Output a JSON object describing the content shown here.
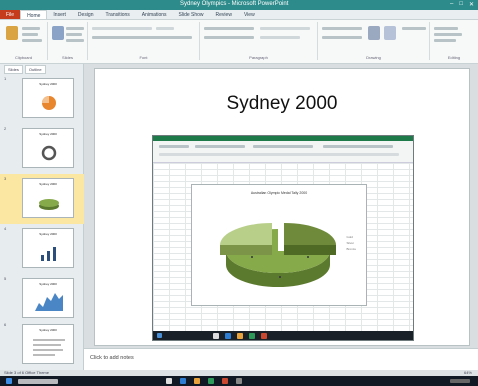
{
  "window": {
    "title": "Sydney Olympics - Microsoft PowerPoint",
    "controls": [
      "–",
      "□",
      "✕"
    ]
  },
  "tabs": [
    {
      "label": "File",
      "kind": "file"
    },
    {
      "label": "Home",
      "kind": "active"
    },
    {
      "label": "Insert",
      "kind": ""
    },
    {
      "label": "Design",
      "kind": ""
    },
    {
      "label": "Transitions",
      "kind": ""
    },
    {
      "label": "Animations",
      "kind": ""
    },
    {
      "label": "Slide Show",
      "kind": ""
    },
    {
      "label": "Review",
      "kind": ""
    },
    {
      "label": "View",
      "kind": ""
    }
  ],
  "ribbon": {
    "groups": [
      "Clipboard",
      "Slides",
      "Font",
      "Paragraph",
      "Drawing",
      "Editing"
    ]
  },
  "panel": {
    "tabs": [
      "Slides",
      "Outline"
    ]
  },
  "thumbnails": [
    {
      "num": "1",
      "title": "Sydney 2000",
      "kind": "pie-orange",
      "selected": false
    },
    {
      "num": "2",
      "title": "Sydney 2000",
      "kind": "donut",
      "selected": false
    },
    {
      "num": "3",
      "title": "Sydney 2000",
      "kind": "pie-green",
      "selected": true
    },
    {
      "num": "4",
      "title": "Sydney 2000",
      "kind": "bars",
      "selected": false
    },
    {
      "num": "5",
      "title": "Sydney 2000",
      "kind": "area",
      "selected": false
    },
    {
      "num": "6",
      "title": "Sydney 2000",
      "kind": "text",
      "selected": false
    }
  ],
  "slide": {
    "title": "Sydney 2000"
  },
  "embedded_chart": {
    "title": "Australian Olympic Medal Tally 2000",
    "legend": [
      "Gold",
      "Silver",
      "Bronze"
    ]
  },
  "notes": {
    "placeholder": "Click to add notes"
  },
  "status": {
    "left": "Slide 3 of 6   Office Theme",
    "zoom": "64%"
  },
  "colors": {
    "accent": "#2e8b8b",
    "pie_dark": "#5c7a2e",
    "pie_mid": "#86a94a",
    "pie_light": "#b8cf8a"
  }
}
